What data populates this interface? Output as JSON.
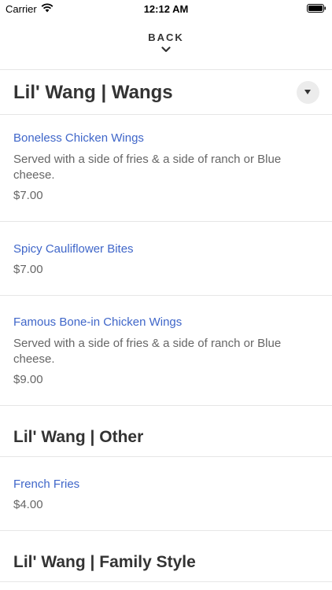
{
  "status_bar": {
    "carrier": "Carrier",
    "time": "12:12 AM",
    "icons": [
      "wifi-icon",
      "battery-icon"
    ]
  },
  "nav": {
    "back_label": "BACK",
    "chevron_icon": "chevron-down-icon"
  },
  "colors": {
    "link_blue": "#3f66c9",
    "text_dark": "#333333",
    "text_muted": "#666666"
  },
  "sections": [
    {
      "title": "Lil' Wang | Wangs",
      "items": [
        {
          "name": "Boneless Chicken Wings",
          "description": "Served with a side of fries & a side of ranch or Blue cheese.",
          "price": "$7.00"
        },
        {
          "name": "Spicy Cauliflower Bites",
          "price": "$7.00"
        },
        {
          "name": "Famous Bone-in Chicken Wings",
          "description": "Served with a side of fries & a side of ranch or Blue cheese.",
          "price": "$9.00"
        }
      ]
    },
    {
      "title": "Lil' Wang | Other",
      "items": [
        {
          "name": "French Fries",
          "price": "$4.00"
        }
      ]
    },
    {
      "title": "Lil' Wang | Family Style"
    }
  ]
}
